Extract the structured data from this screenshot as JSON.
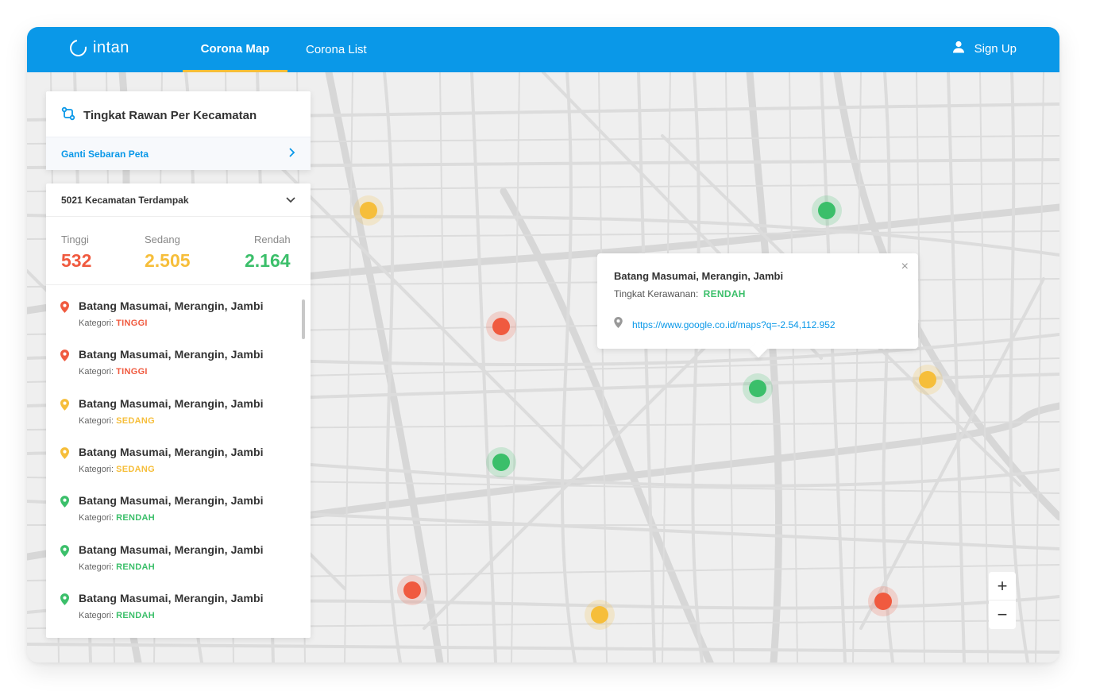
{
  "header": {
    "logo_text": "intan",
    "nav": [
      {
        "label": "Corona Map",
        "active": true
      },
      {
        "label": "Corona List",
        "active": false
      }
    ],
    "signup_label": "Sign Up",
    "accent": "#0a98e8",
    "active_indicator": "#f6be3a"
  },
  "panel": {
    "title": "Tingkat Rawan Per Kecamatan",
    "switch_link": "Ganti Sebaran Peta",
    "dropdown_label": "5021 Kecamatan Terdampak",
    "stats": [
      {
        "label": "Tinggi",
        "value": "532",
        "color": "#f05a3f"
      },
      {
        "label": "Sedang",
        "value": "2.505",
        "color": "#f6be3a"
      },
      {
        "label": "Rendah",
        "value": "2.164",
        "color": "#3bbf6a"
      }
    ],
    "category_prefix": "Kategori: ",
    "items": [
      {
        "name": "Batang Masumai, Merangin, Jambi",
        "category": "TINGGI",
        "color": "#f05a3f"
      },
      {
        "name": "Batang Masumai, Merangin, Jambi",
        "category": "TINGGI",
        "color": "#f05a3f"
      },
      {
        "name": "Batang Masumai, Merangin, Jambi",
        "category": "SEDANG",
        "color": "#f6be3a"
      },
      {
        "name": "Batang Masumai, Merangin, Jambi",
        "category": "SEDANG",
        "color": "#f6be3a"
      },
      {
        "name": "Batang Masumai, Merangin, Jambi",
        "category": "RENDAH",
        "color": "#3bbf6a"
      },
      {
        "name": "Batang Masumai, Merangin, Jambi",
        "category": "RENDAH",
        "color": "#3bbf6a"
      },
      {
        "name": "Batang Masumai, Merangin, Jambi",
        "category": "RENDAH",
        "color": "#3bbf6a"
      }
    ]
  },
  "popup": {
    "title": "Batang Masumai, Merangin, Jambi",
    "level_label": "Tingkat Kerawanan:",
    "level_value": "RENDAH",
    "level_color": "#3bbf6a",
    "link": "https://www.google.co.id/maps?q=-2.54,112.952",
    "close_symbol": "×"
  },
  "map": {
    "markers": [
      {
        "level": "SEDANG",
        "color": "#f6be3a"
      },
      {
        "level": "RENDAH",
        "color": "#3bbf6a"
      },
      {
        "level": "TINGGI",
        "color": "#f05a3f"
      },
      {
        "level": "RENDAH",
        "color": "#3bbf6a"
      },
      {
        "level": "SEDANG",
        "color": "#f6be3a"
      },
      {
        "level": "RENDAH",
        "color": "#3bbf6a"
      },
      {
        "level": "TINGGI",
        "color": "#f05a3f"
      },
      {
        "level": "SEDANG",
        "color": "#f6be3a"
      },
      {
        "level": "TINGGI",
        "color": "#f05a3f"
      }
    ],
    "zoom_in": "+",
    "zoom_out": "−"
  }
}
